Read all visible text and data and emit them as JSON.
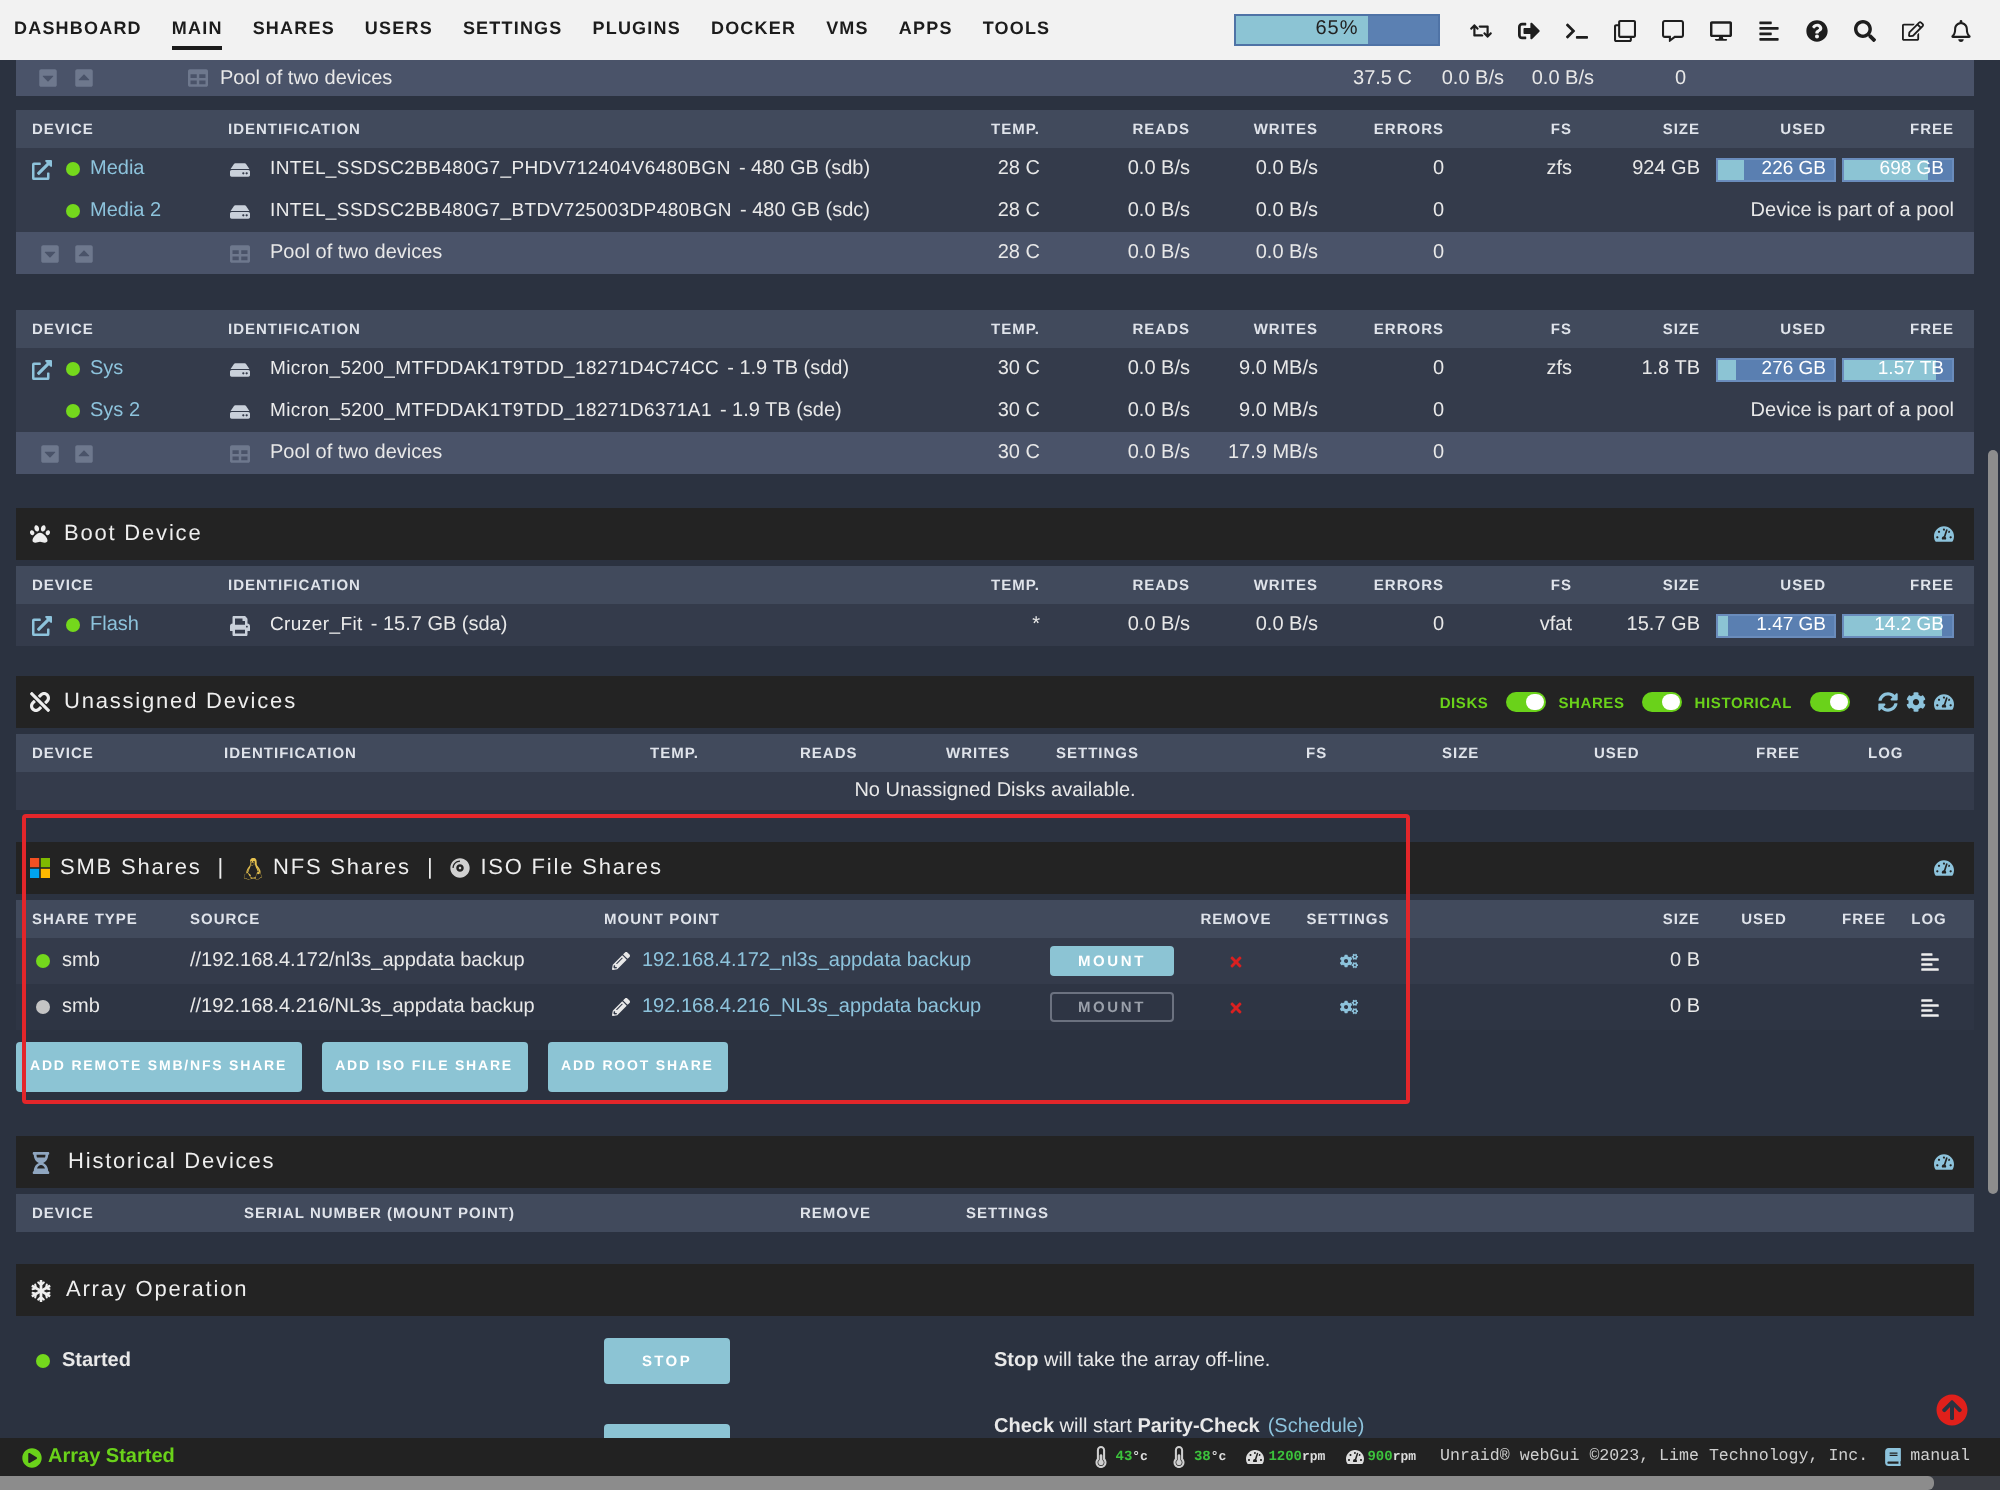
{
  "nav": {
    "tabs": [
      {
        "label": "DASHBOARD",
        "selected": false
      },
      {
        "label": "MAIN",
        "selected": true
      },
      {
        "label": "SHARES",
        "selected": false
      },
      {
        "label": "USERS",
        "selected": false
      },
      {
        "label": "SETTINGS",
        "selected": false
      },
      {
        "label": "PLUGINS",
        "selected": false
      },
      {
        "label": "DOCKER",
        "selected": false
      },
      {
        "label": "VMS",
        "selected": false
      },
      {
        "label": "APPS",
        "selected": false
      },
      {
        "label": "TOOLS",
        "selected": false
      }
    ],
    "progress": {
      "label": "65%",
      "level": 0.65
    }
  },
  "partial_pool_row": {
    "identification": "Pool of two devices",
    "temp": "37.5 C",
    "reads": "0.0 B/s",
    "writes": "0.0 B/s",
    "errors": "0"
  },
  "pools": [
    {
      "columns": [
        "DEVICE",
        "IDENTIFICATION",
        "TEMP.",
        "READS",
        "WRITES",
        "ERRORS",
        "FS",
        "SIZE",
        "USED",
        "FREE"
      ],
      "devices": [
        {
          "kind": "primary",
          "color": "#74d81c",
          "name": "Media",
          "model": "INTEL_SSDSC2BB480G7_PHDV712404V6480BGN",
          "detail": "- 480 GB (sdb)",
          "temp": "28 C",
          "reads": "0.0 B/s",
          "writes": "0.0 B/s",
          "errors": "0",
          "fs": "zfs",
          "size": "924 GB",
          "used": {
            "label": "226 GB",
            "level": 0.23
          },
          "free": {
            "label": "698 GB",
            "level": 0.77
          }
        },
        {
          "kind": "member",
          "color": "#74d81c",
          "name": "Media 2",
          "model": "INTEL_SSDSC2BB480G7_BTDV725003DP480BGN",
          "detail": "- 480 GB (sdc)",
          "temp": "28 C",
          "reads": "0.0 B/s",
          "writes": "0.0 B/s",
          "errors": "0",
          "note": "Device is part of a pool"
        }
      ],
      "summary": {
        "label": "Pool of two devices",
        "temp": "28 C",
        "reads": "0.0 B/s",
        "writes": "0.0 B/s",
        "errors": "0"
      }
    },
    {
      "columns": [
        "DEVICE",
        "IDENTIFICATION",
        "TEMP.",
        "READS",
        "WRITES",
        "ERRORS",
        "FS",
        "SIZE",
        "USED",
        "FREE"
      ],
      "devices": [
        {
          "kind": "primary",
          "color": "#74d81c",
          "name": "Sys",
          "model": "Micron_5200_MTFDDAK1T9TDD_18271D4C74CC",
          "detail": "- 1.9 TB (sdd)",
          "temp": "30 C",
          "reads": "0.0 B/s",
          "writes": "9.0 MB/s",
          "errors": "0",
          "fs": "zfs",
          "size": "1.8 TB",
          "used": {
            "label": "276 GB",
            "level": 0.15
          },
          "free": {
            "label": "1.57 TB",
            "level": 0.85
          }
        },
        {
          "kind": "member",
          "color": "#74d81c",
          "name": "Sys 2",
          "model": "Micron_5200_MTFDDAK1T9TDD_18271D6371A1",
          "detail": "- 1.9 TB (sde)",
          "temp": "30 C",
          "reads": "0.0 B/s",
          "writes": "9.0 MB/s",
          "errors": "0",
          "note": "Device is part of a pool"
        }
      ],
      "summary": {
        "label": "Pool of two devices",
        "temp": "30 C",
        "reads": "0.0 B/s",
        "writes": "17.9 MB/s",
        "errors": "0"
      }
    }
  ],
  "boot": {
    "title": "Boot Device",
    "columns": [
      "DEVICE",
      "IDENTIFICATION",
      "TEMP.",
      "READS",
      "WRITES",
      "ERRORS",
      "FS",
      "SIZE",
      "USED",
      "FREE"
    ],
    "devices": [
      {
        "kind": "primary",
        "color": "#74d81c",
        "name": "Flash",
        "model": "Cruzer_Fit",
        "detail": "- 15.7 GB (sda)",
        "temp": "*",
        "reads": "0.0 B/s",
        "writes": "0.0 B/s",
        "errors": "0",
        "fs": "vfat",
        "size": "15.7 GB",
        "used": {
          "label": "1.47 GB",
          "level": 0.09
        },
        "free": {
          "label": "14.2 GB",
          "level": 0.91
        }
      }
    ]
  },
  "unassigned": {
    "title": "Unassigned Devices",
    "toggles": [
      {
        "label": "DISKS",
        "on": true
      },
      {
        "label": "SHARES",
        "on": true
      },
      {
        "label": "HISTORICAL",
        "on": true
      }
    ],
    "columns": [
      "DEVICE",
      "IDENTIFICATION",
      "TEMP.",
      "READS",
      "WRITES",
      "SETTINGS",
      "FS",
      "SIZE",
      "USED",
      "FREE",
      "LOG"
    ],
    "message": "No Unassigned Disks available."
  },
  "remote_shares": {
    "title_parts": [
      {
        "kind": "smb",
        "label": "SMB Shares"
      },
      {
        "kind": "separator",
        "label": "|"
      },
      {
        "kind": "nfs",
        "label": "NFS Shares"
      },
      {
        "kind": "separator",
        "label": "|"
      },
      {
        "kind": "iso",
        "label": "ISO File Shares"
      }
    ],
    "columns": [
      "SHARE TYPE",
      "SOURCE",
      "MOUNT POINT",
      "REMOVE",
      "SETTINGS",
      "SIZE",
      "USED",
      "FREE",
      "LOG"
    ],
    "rows": [
      {
        "color": "#74d81c",
        "type": "smb",
        "source": "//192.168.4.172/nl3s_appdata backup",
        "mount_point": "192.168.4.172_nl3s_appdata backup",
        "mount": {
          "label": "MOUNT",
          "disabled": false
        },
        "size": "0 B"
      },
      {
        "color": "#c4c4c4",
        "type": "smb",
        "source": "//192.168.4.216/NL3s_appdata backup",
        "mount_point": "192.168.4.216_NL3s_appdata backup",
        "mount": {
          "label": "MOUNT",
          "disabled": true
        },
        "size": "0 B"
      }
    ],
    "buttons": [
      "ADD REMOTE SMB/NFS SHARE",
      "ADD ISO FILE SHARE",
      "ADD ROOT SHARE"
    ]
  },
  "historical": {
    "title": "Historical Devices",
    "columns": [
      "DEVICE",
      "SERIAL NUMBER (MOUNT POINT)",
      "REMOVE",
      "SETTINGS"
    ]
  },
  "array_operation": {
    "title": "Array Operation",
    "rows": [
      {
        "kind": "status",
        "color": "#74d81c",
        "status": "Started",
        "button": "STOP",
        "description": "**Stop** will take the array off-line."
      },
      {
        "kind": "action",
        "description": "**Check** will start **Parity-Check**",
        "link": "(Schedule)"
      }
    ]
  },
  "footer": {
    "status": "Array Started",
    "sensors": [
      {
        "kind": "temperature",
        "value": "43",
        "unit": "°c"
      },
      {
        "kind": "temperature",
        "value": "38",
        "unit": "°c"
      },
      {
        "kind": "fan",
        "value": "1200",
        "unit": "rpm"
      },
      {
        "kind": "fan",
        "value": "900",
        "unit": "rpm"
      }
    ],
    "copyright": "Unraid® webGui ©2023, Lime Technology, Inc.",
    "manual": "manual"
  }
}
